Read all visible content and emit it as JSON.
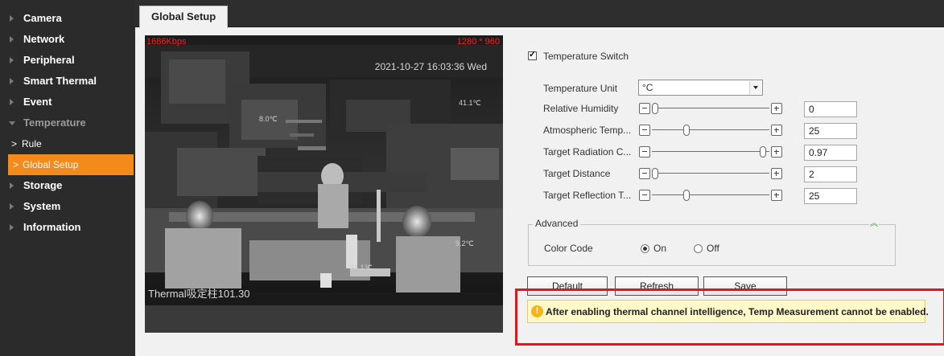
{
  "sidebar": {
    "items": [
      {
        "label": "Camera"
      },
      {
        "label": "Network"
      },
      {
        "label": "Peripheral"
      },
      {
        "label": "Smart Thermal"
      },
      {
        "label": "Event"
      },
      {
        "label": "Temperature"
      },
      {
        "label": "Storage"
      },
      {
        "label": "System"
      },
      {
        "label": "Information"
      }
    ],
    "subitems": [
      {
        "label": "Rule"
      },
      {
        "label": "Global Setup"
      }
    ]
  },
  "tab": {
    "label": "Global Setup"
  },
  "video": {
    "bitrate": "1686Kbps",
    "resolution": "1280 * 960",
    "timestamp": "2021-10-27 16:03:36 Wed",
    "channel_name": "Thermal吸定柱101.30",
    "temp_points": [
      "8.0℃",
      "41.1℃",
      "9.2℃",
      "34.1℃"
    ]
  },
  "settings": {
    "temperature_switch": {
      "label": "Temperature Switch",
      "checked": true
    },
    "temperature_unit": {
      "label": "Temperature Unit",
      "value": "°C"
    },
    "sliders": [
      {
        "label": "Relative Humidity",
        "value": "0",
        "fraction": 0.0
      },
      {
        "label": "Atmospheric Temp...",
        "value": "25",
        "fraction": 0.28
      },
      {
        "label": "Target Radiation C...",
        "value": "0.97",
        "fraction": 0.97
      },
      {
        "label": "Target Distance",
        "value": "2",
        "fraction": 0.0
      },
      {
        "label": "Target Reflection T...",
        "value": "25",
        "fraction": 0.28
      }
    ]
  },
  "advanced": {
    "label": "Advanced",
    "color_code": {
      "label": "Color Code",
      "on_label": "On",
      "off_label": "Off",
      "selected": "On"
    }
  },
  "buttons": {
    "default": "Default",
    "refresh": "Refresh",
    "save": "Save"
  },
  "warning": {
    "text": "After enabling thermal channel intelligence, Temp Measurement cannot be enabled."
  },
  "colors": {
    "sidebar_bg": "#2b2b2b",
    "active": "#f38a1c",
    "warning_outline": "#e5141b",
    "warning_bg": "#fff8c9"
  },
  "icons": {
    "warning": "warning-circle-icon",
    "advanced_toggle": "double-chevron-up-icon"
  }
}
